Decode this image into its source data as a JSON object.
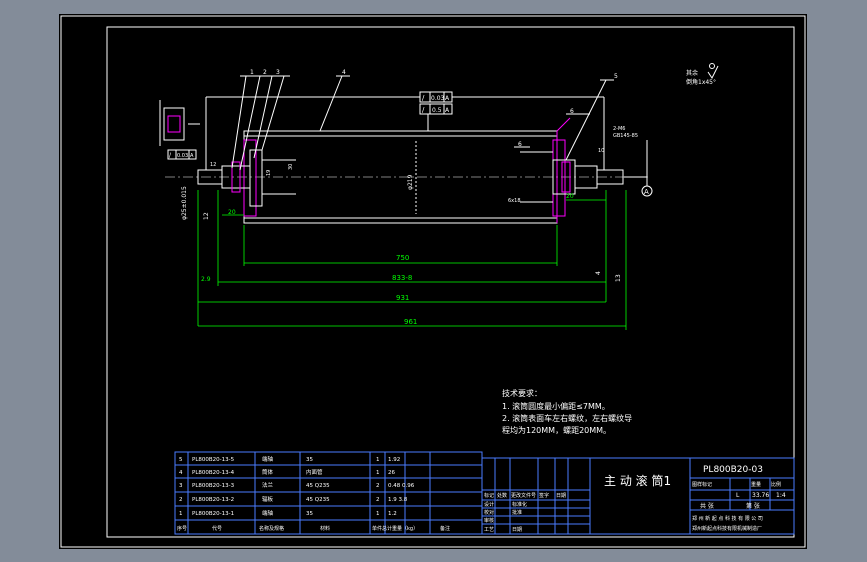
{
  "callouts": [
    "1",
    "2",
    "3",
    "4",
    "5"
  ],
  "tolerance_frames": {
    "top1": [
      "/",
      "0.03",
      "A"
    ],
    "top2": [
      "/",
      "0.5",
      "A"
    ],
    "left": [
      "/",
      "0.03",
      "A"
    ]
  },
  "surface_symbol": {
    "label": "其余",
    "spec": "倒角1x45°"
  },
  "datum_label": "A",
  "leader_labels": [
    "6",
    "6"
  ],
  "dims": {
    "d750": "750",
    "d833": "833-8",
    "d931": "931",
    "d961": "961",
    "d2_9": "2.9",
    "d12": "12",
    "dtube": "φ219",
    "dshaft_l": "φ25±0.015",
    "dwall": "4",
    "dbore": "6x18",
    "dspec": "2-M6",
    "dspec2": "GB145-85",
    "d20": "20",
    "d20b": "20",
    "d19": "19",
    "d30": "30",
    "d12b": "12",
    "d13": "13",
    "d10": "10"
  },
  "notes": {
    "title": "技术要求：",
    "line1": "1.  滚筒圆度最小偏距≤7MM。",
    "line2": "2.  滚筒表面车左右螺纹，左右螺纹导",
    "line3": "程均为120MM，螺距20MM。"
  },
  "bom": [
    {
      "no": "5",
      "code": "PL800B20-13-5",
      "name": "端轴",
      "qty": "35",
      "q1": "1",
      "w": "1.92"
    },
    {
      "no": "4",
      "code": "PL800B20-13-4",
      "name": "筒体",
      "qty": "内面管",
      "q1": "1",
      "w": "26"
    },
    {
      "no": "3",
      "code": "PL800B20-13-3",
      "name": "法兰",
      "qty": "45  Q235",
      "q1": "2",
      "w": "0.48  0.96"
    },
    {
      "no": "2",
      "code": "PL800B20-13-2",
      "name": "辐板",
      "qty": "45  Q235",
      "q1": "2",
      "w": "1.9  3.8"
    },
    {
      "no": "1",
      "code": "PL800B20-13-1",
      "name": "端轴",
      "qty": "35",
      "q1": "1",
      "w": "1.2"
    }
  ],
  "bom_header": {
    "no": "序号",
    "code": "代号",
    "name": "名称及规格",
    "material": "材料",
    "weight": "单件总计重量（kg）",
    "remark": "备注"
  },
  "title_block": {
    "part_name": "主 动 滚 筒1",
    "drawing_no": "PL800B20-03",
    "stage_label": "图样标记",
    "weight_label": "重量",
    "scale_label": "比例",
    "weight": "33.76",
    "scale": "1:4",
    "sheets": "共  张",
    "sheet": "第  张",
    "company1": "郑 州 新 起 点 科 技 有 限 公 司",
    "company2": "郑州新起点科技有限机械制造厂",
    "mark_s": "L",
    "rev_row": [
      "标记",
      "处数",
      "更改文件号",
      "签字",
      "日期"
    ],
    "design": "设计",
    "check": "校对",
    "review": "审核",
    "process": "工艺",
    "standard": "标准化",
    "approve": "批准",
    "date": "日期"
  }
}
